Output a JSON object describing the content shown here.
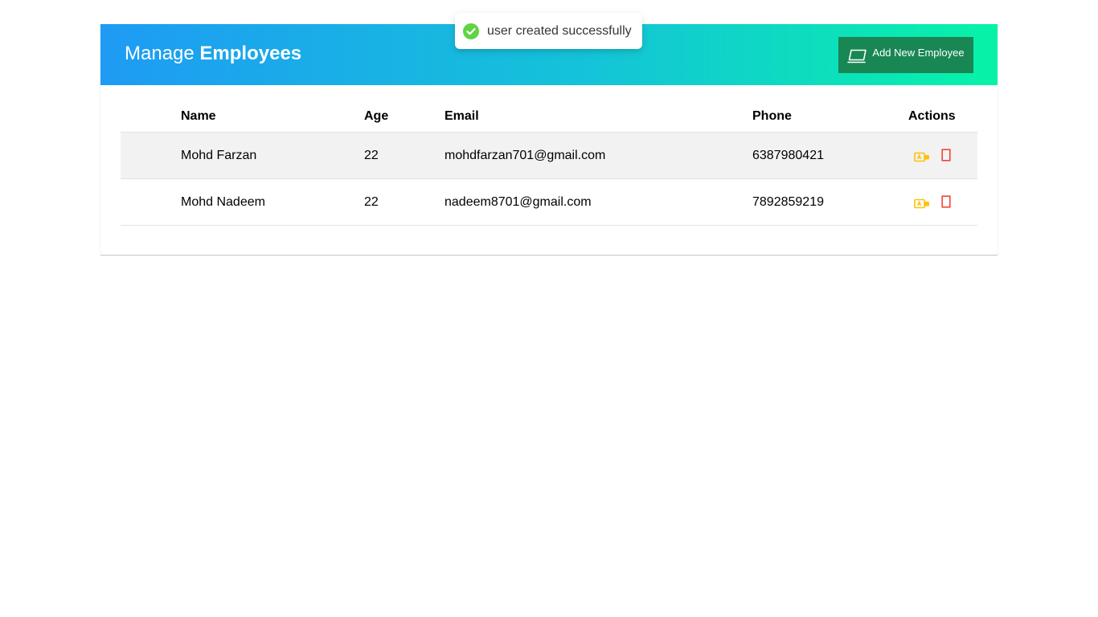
{
  "header": {
    "title_light": "Manage",
    "title_bold": "Employees",
    "add_button_label": "Add New Employee",
    "add_button_icon": "laptop-icon"
  },
  "toast": {
    "message": "user created successfully",
    "icon": "check-circle-icon",
    "status_color": "#61d345"
  },
  "table": {
    "columns": [
      "Name",
      "Age",
      "Email",
      "Phone",
      "Actions"
    ],
    "rows": [
      {
        "name": "Mohd Farzan",
        "age": "22",
        "email": "mohdfarzan701@gmail.com",
        "phone": "6387980421"
      },
      {
        "name": "Mohd Nadeem",
        "age": "22",
        "email": "nadeem8701@gmail.com",
        "phone": "7892859219"
      }
    ],
    "row_actions": [
      {
        "name": "edit",
        "icon": "edit-icon",
        "color": "#ffc107"
      },
      {
        "name": "delete",
        "icon": "delete-icon",
        "color": "#f44336"
      }
    ]
  },
  "colors": {
    "header_gradient_start": "#1e9bf4",
    "header_gradient_end": "#07f3a8",
    "add_button_bg": "#198754",
    "stripe_bg": "#f2f2f2"
  }
}
